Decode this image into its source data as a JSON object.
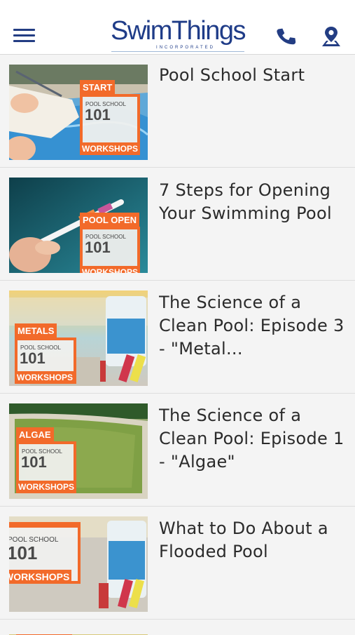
{
  "header": {
    "logo_text": "SwimThings",
    "logo_sub": "INCORPORATED",
    "menu_icon": "hamburger-menu-icon",
    "phone_icon": "phone-icon",
    "map_icon": "map-pin-icon"
  },
  "colors": {
    "brand": "#1f3c88",
    "accent": "#f26a2a",
    "background": "#f4f4f4"
  },
  "badge_common": {
    "small": "POOL SCHOOL",
    "num": "101",
    "ws": "WORKSHOPS"
  },
  "videos": [
    {
      "title": "Pool School Start",
      "tag": "START"
    },
    {
      "title": "7 Steps for Opening Your Swimming Pool",
      "tag": "POOL OPEN"
    },
    {
      "title": "The Science of a Clean Pool: Episode 3 - \"Metal...",
      "tag": "METALS"
    },
    {
      "title": "The Science of a Clean Pool: Episode 1 - \"Algae\"",
      "tag": "ALGAE"
    },
    {
      "title": "What to Do About a Flooded Pool",
      "tag": ""
    }
  ]
}
